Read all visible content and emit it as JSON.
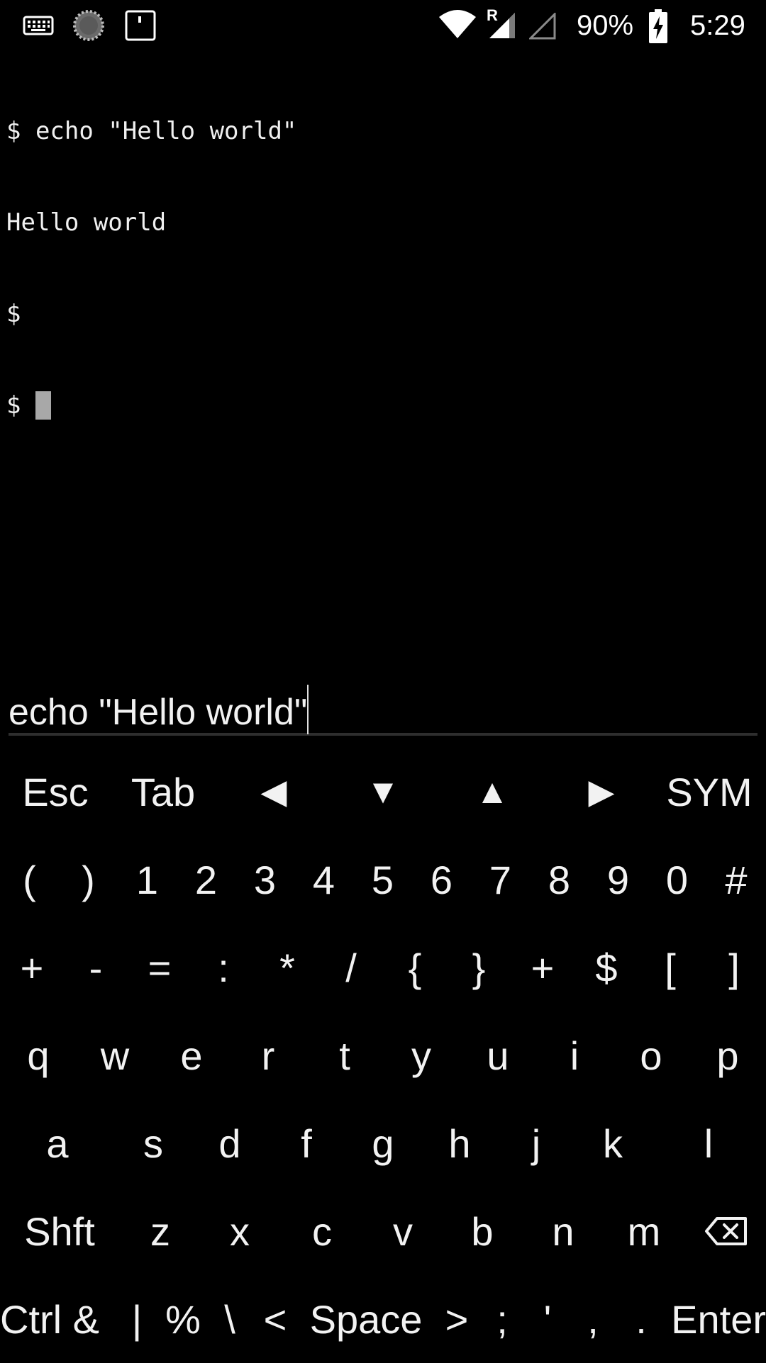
{
  "status_bar": {
    "battery_percent": "90%",
    "time": "5:29",
    "icons": [
      "keyboard-icon",
      "loading-spinner-icon",
      "sd-card-icon",
      "wifi-icon",
      "roaming-signal-icon",
      "no-signal-icon",
      "battery-charging-icon"
    ],
    "roaming_letter": "R"
  },
  "terminal": {
    "lines": [
      "$ echo \"Hello world\"",
      "Hello world",
      "$"
    ],
    "prompt": "$ "
  },
  "command_input": {
    "value": "echo \"Hello world\""
  },
  "keyboard": {
    "rows": [
      [
        "Esc",
        "Tab",
        "◀",
        "▼",
        "▲",
        "▶",
        "SYM"
      ],
      [
        "(",
        ")",
        "1",
        "2",
        "3",
        "4",
        "5",
        "6",
        "7",
        "8",
        "9",
        "0",
        "#"
      ],
      [
        "+",
        "-",
        "=",
        ":",
        "*",
        "/",
        "{",
        "}",
        "+",
        "$",
        "[",
        "]"
      ],
      [
        "q",
        "w",
        "e",
        "r",
        "t",
        "y",
        "u",
        "i",
        "o",
        "p"
      ],
      [
        "a",
        "s",
        "d",
        "f",
        "g",
        "h",
        "j",
        "k",
        "l"
      ],
      [
        "Shft",
        "z",
        "x",
        "c",
        "v",
        "b",
        "n",
        "m",
        "⌫"
      ],
      [
        "Ctrl &",
        "|",
        "%",
        "\\",
        "<",
        "Space",
        ">",
        ";",
        "'",
        ",",
        ".",
        "Enter"
      ]
    ]
  }
}
